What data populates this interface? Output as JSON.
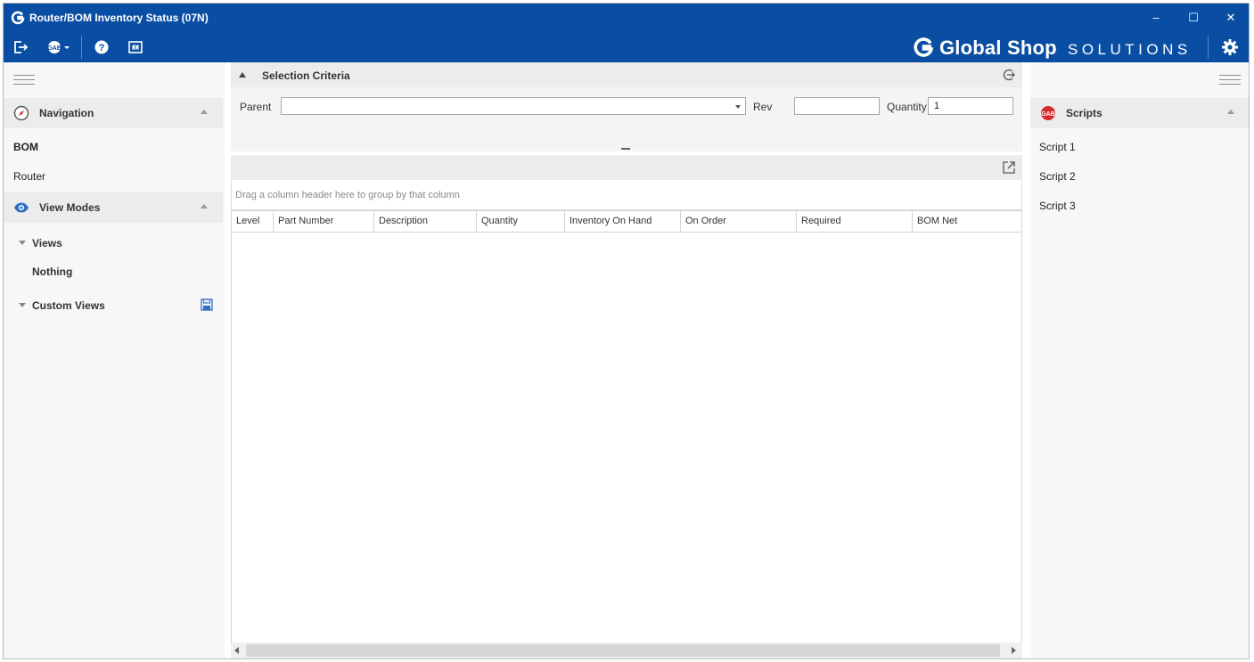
{
  "window": {
    "title": "Router/BOM Inventory Status (07N)",
    "controls": {
      "minimize": "–",
      "maximize": "☐",
      "close": "✕"
    }
  },
  "toolbar": {
    "icons": [
      "exit-icon",
      "gab-dropdown-icon",
      "help-icon",
      "screen-layout-icon"
    ]
  },
  "brand": {
    "name": "Global Shop",
    "suffix": "SOLUTIONS"
  },
  "left_panel": {
    "navigation": {
      "title": "Navigation",
      "items": [
        {
          "label": "BOM",
          "selected": true
        },
        {
          "label": "Router",
          "selected": false
        }
      ]
    },
    "view_modes": {
      "title": "View Modes",
      "views_label": "Views",
      "views": [
        "Nothing"
      ],
      "custom_views_label": "Custom Views"
    }
  },
  "criteria": {
    "title": "Selection Criteria",
    "parent_label": "Parent",
    "parent_value": "",
    "rev_label": "Rev",
    "rev_value": "",
    "quantity_label": "Quantity",
    "quantity_value": "1"
  },
  "grid": {
    "group_hint": "Drag a column header here to group by that column",
    "columns": [
      "Level",
      "Part Number",
      "Description",
      "Quantity",
      "Inventory On Hand",
      "On Order",
      "Required",
      "BOM Net"
    ],
    "rows": []
  },
  "right_panel": {
    "scripts": {
      "title": "Scripts",
      "items": [
        "Script 1",
        "Script 2",
        "Script 3"
      ]
    }
  },
  "colors": {
    "titlebar": "#0a4ea3",
    "panel_header": "#ececec",
    "accent_red": "#d62b2b",
    "view_icon_blue": "#2f6fc4"
  }
}
